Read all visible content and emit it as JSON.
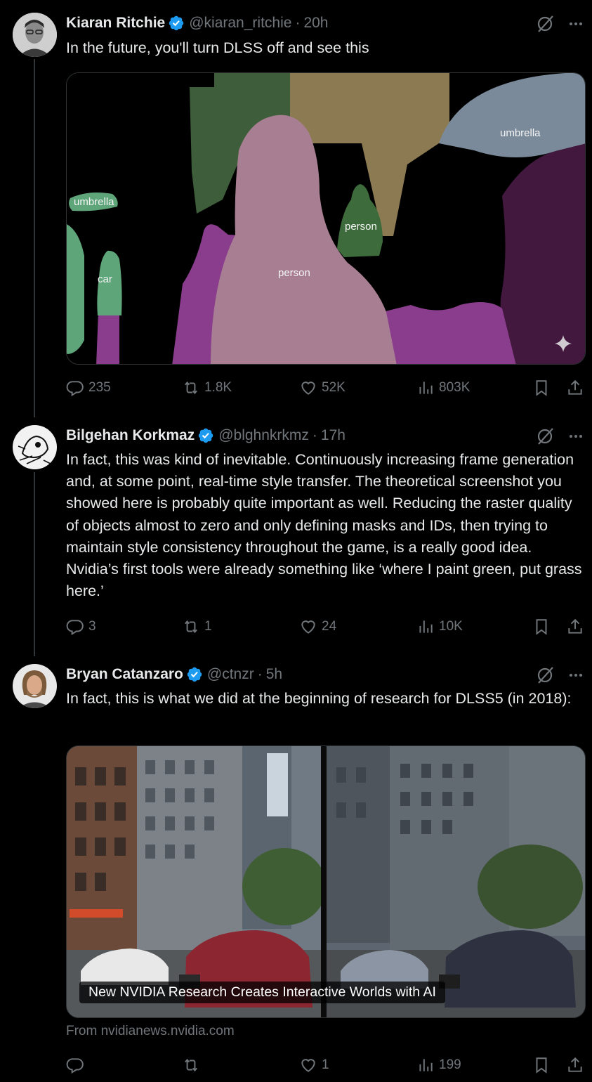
{
  "tweets": [
    {
      "name": "Kiaran Ritchie",
      "handle": "@kiaran_ritchie",
      "time": "20h",
      "text": "In the future, you'll turn DLSS off and see this",
      "media_labels": [
        "umbrella",
        "umbrella",
        "person",
        "person",
        "car"
      ],
      "actions": {
        "replies": "235",
        "reposts": "1.8K",
        "likes": "52K",
        "views": "803K"
      }
    },
    {
      "name": "Bilgehan Korkmaz",
      "handle": "@blghnkrkmz",
      "time": "17h",
      "text": "In fact, this was kind of inevitable. Continuously increasing frame generation and, at some point, real-time style transfer. The theoretical screenshot you showed here is probably quite important as well. Reducing the raster quality of objects almost to zero and only defining masks and IDs, then trying to maintain style consistency throughout the game, is a really good idea. Nvidia’s first tools were already something like ‘where I paint green, put grass here.’",
      "actions": {
        "replies": "3",
        "reposts": "1",
        "likes": "24",
        "views": "10K"
      }
    },
    {
      "name": "Bryan Catanzaro",
      "handle": "@ctnzr",
      "time": "5h",
      "text": "In fact, this is what we did at the beginning of research for DLSS5 (in 2018):",
      "card_title": "New NVIDIA Research Creates Interactive Worlds with AI",
      "card_source": "From nvidianews.nvidia.com",
      "actions": {
        "replies": "",
        "reposts": "",
        "likes": "1",
        "views": "199"
      }
    }
  ],
  "separator": "·",
  "colors": {
    "accent": "#1d9bf0",
    "secondary_text": "#71767b",
    "background": "#000000"
  },
  "icons": [
    "verified-badge-icon",
    "grok-icon",
    "more-icon",
    "reply-icon",
    "repost-icon",
    "like-icon",
    "views-icon",
    "bookmark-icon",
    "share-icon",
    "sparkle-icon"
  ]
}
